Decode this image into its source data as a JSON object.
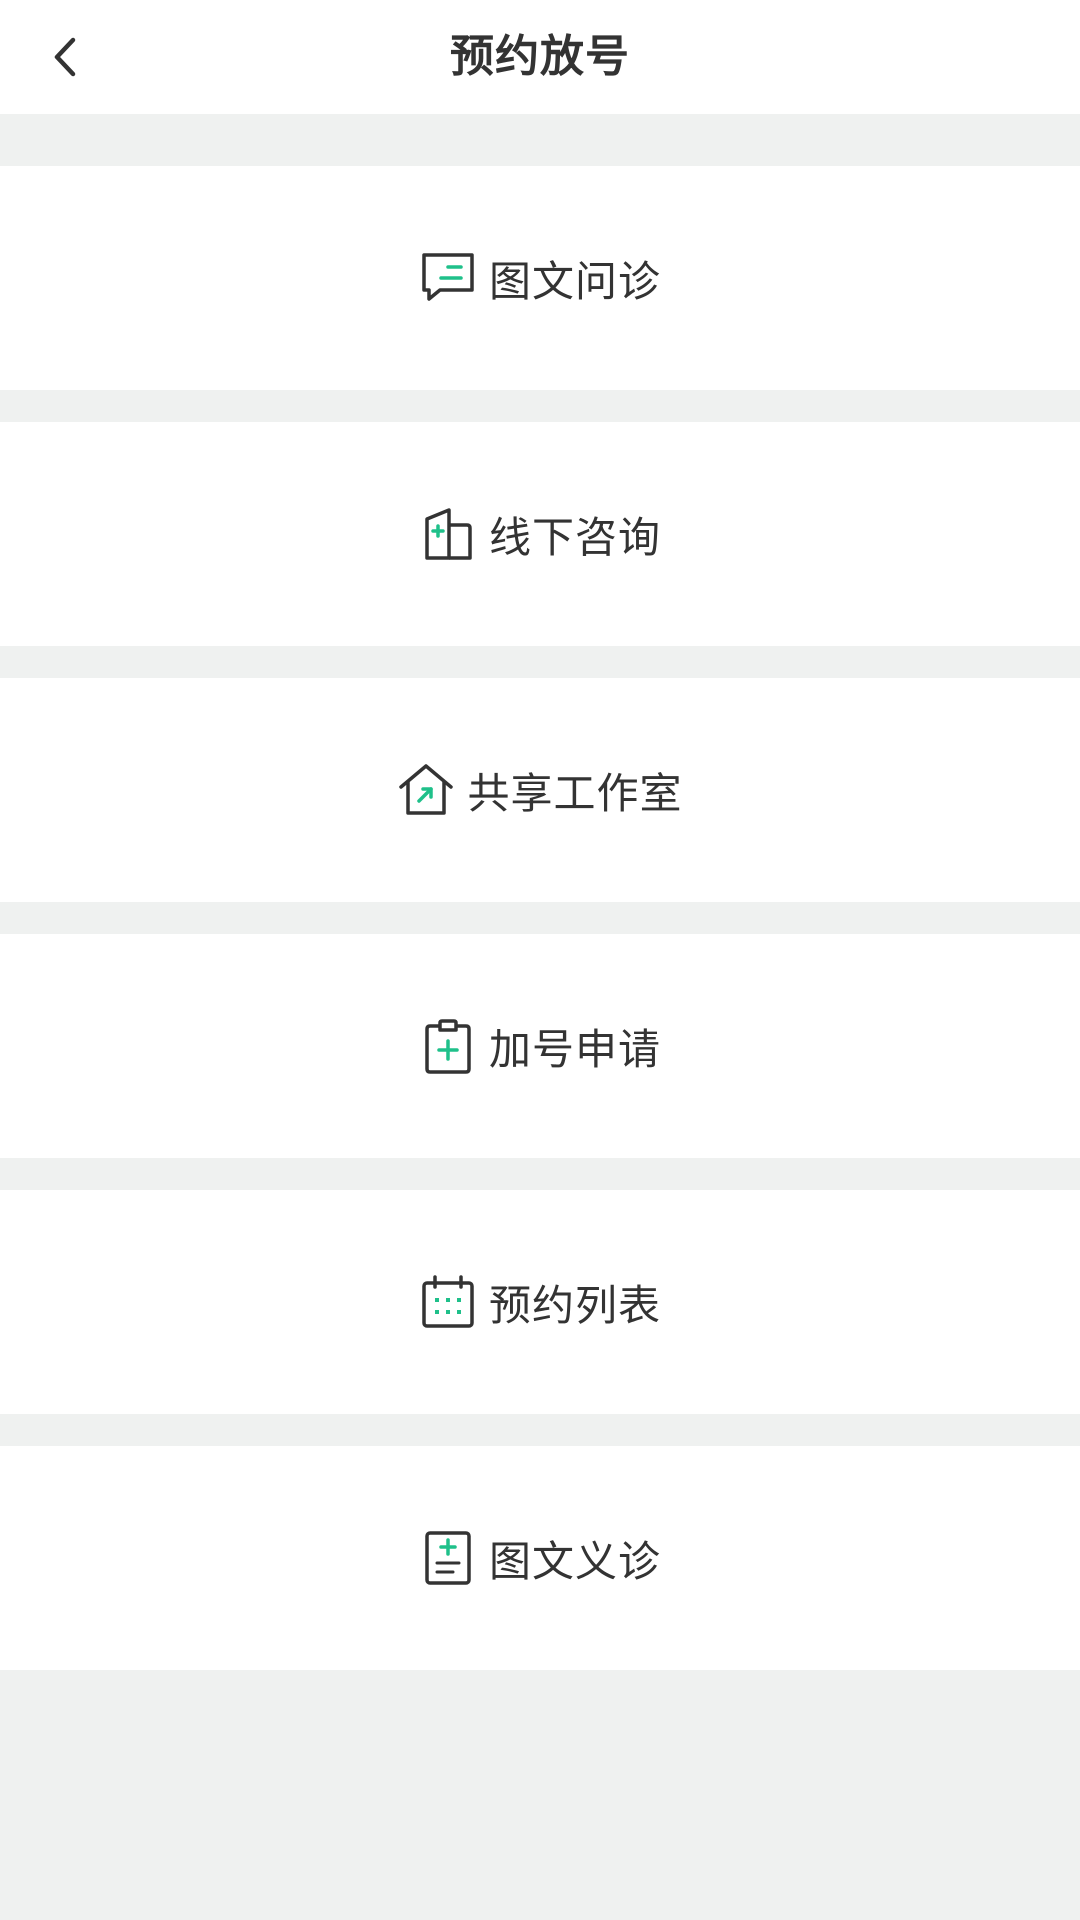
{
  "header": {
    "title": "预约放号"
  },
  "menu": {
    "items": [
      {
        "label": "图文问诊",
        "icon": "chat-bubble-icon"
      },
      {
        "label": "线下咨询",
        "icon": "clinic-building-icon"
      },
      {
        "label": "共享工作室",
        "icon": "shared-home-icon"
      },
      {
        "label": "加号申请",
        "icon": "clipboard-plus-icon"
      },
      {
        "label": "预约列表",
        "icon": "calendar-icon"
      },
      {
        "label": "图文义诊",
        "icon": "document-plus-icon"
      }
    ]
  },
  "colors": {
    "accent": "#1fc08a",
    "icon_stroke": "#333333",
    "background": "#eff1f0",
    "card": "#ffffff"
  }
}
